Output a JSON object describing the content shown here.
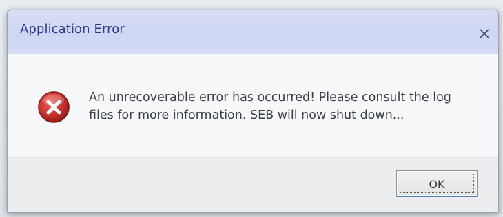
{
  "window": {
    "title": "Application Error",
    "close_icon": "close-icon"
  },
  "message": {
    "icon": "error-icon",
    "text": "An unrecoverable error has occurred! Please consult the log files for more information. SEB will now shut down..."
  },
  "buttons": {
    "ok_label": "OK"
  },
  "colors": {
    "title_text": "#2b3a8a",
    "titlebar_bg": "#d3d9f4",
    "error_red": "#c62828",
    "body_text": "#3a3f46"
  }
}
